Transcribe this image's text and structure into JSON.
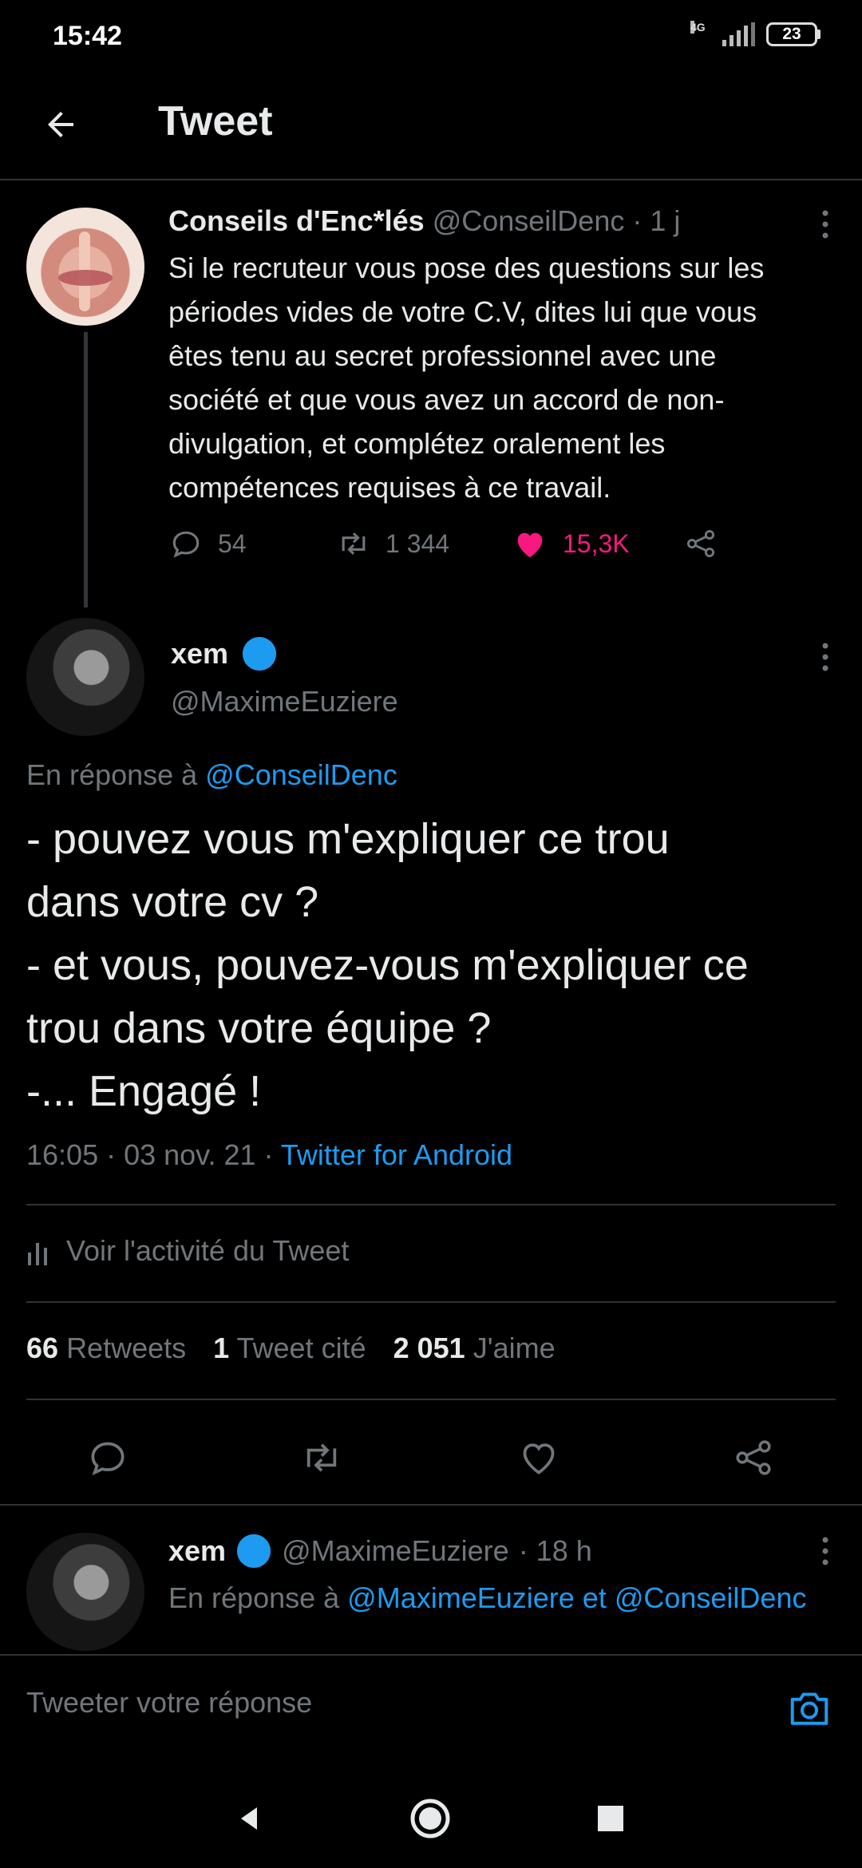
{
  "status_bar": {
    "time": "15:42",
    "network": "4G",
    "battery": "23"
  },
  "header": {
    "title": "Tweet"
  },
  "parent_tweet": {
    "display_name": "Conseils d'Enc*lés",
    "handle": "@ConseilDenc",
    "time": "· 1 j",
    "text": "Si le recruteur vous pose des questions sur les périodes vides de votre C.V, dites lui que vous êtes tenu au secret professionnel avec une société et que vous avez un accord de non-divulgation, et complétez oralement les compétences requises à ce travail.",
    "replies": "54",
    "retweets": "1 344",
    "likes": "15,3K"
  },
  "main_tweet": {
    "display_name": "xem",
    "handle": "@MaximeEuziere",
    "reply_prefix": "En réponse à",
    "reply_mention": "@ConseilDenc",
    "lines": [
      "- pouvez vous m'expliquer ce trou",
      "dans votre cv ?",
      "- et vous, pouvez-vous m'expliquer ce",
      "trou dans votre équipe ?",
      "-... Engagé !"
    ],
    "timestamp": "16:05 · 03 nov. 21 · ",
    "source": "Twitter for Android",
    "activity_label": "Voir l'activité du Tweet",
    "stats": {
      "retweets_count": "66",
      "retweets_label": "Retweets",
      "quotes_count": "1",
      "quotes_label": "Tweet cité",
      "likes_count": "2 051",
      "likes_label": "J'aime"
    }
  },
  "reply_tweet": {
    "display_name": "xem",
    "handle": "@MaximeEuziere",
    "time": "· 18 h",
    "reply_prefix": "En réponse à",
    "reply_mentions": "@MaximeEuziere et @ConseilDenc"
  },
  "composer": {
    "placeholder": "Tweeter votre réponse"
  },
  "colors": {
    "background": "#000000",
    "accent": "#1d9bf0",
    "like": "#f91880",
    "muted": "#71767b"
  },
  "icons": [
    "back-arrow-icon",
    "more-vertical-icon",
    "reply-icon",
    "retweet-icon",
    "heart-icon",
    "share-icon",
    "verified-icon",
    "bar-chart-icon",
    "camera-icon"
  ]
}
